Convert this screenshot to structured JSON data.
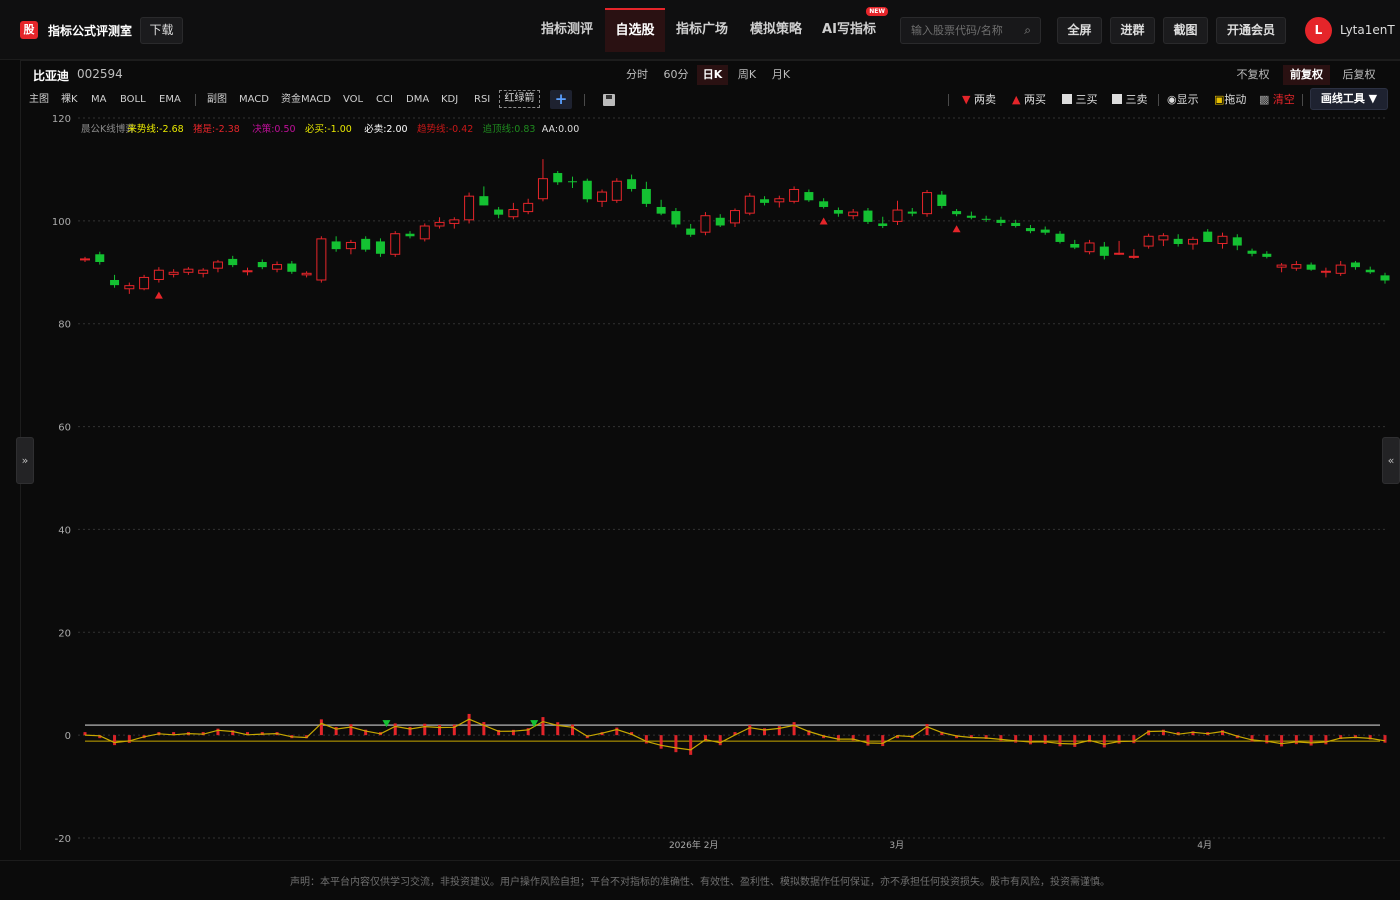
{
  "header": {
    "logo_text": "股",
    "site_name": "指标公式评测室",
    "download_label": "下载",
    "nav": [
      {
        "label": "指标测评",
        "active": false
      },
      {
        "label": "自选股",
        "active": true
      },
      {
        "label": "指标广场",
        "active": false
      },
      {
        "label": "模拟策略",
        "active": false
      },
      {
        "label": "AI写指标",
        "active": false,
        "badge": "NEW"
      }
    ],
    "search_placeholder": "输入股票代码/名称",
    "buttons": [
      "全屏",
      "进群",
      "截图",
      "开通会员"
    ],
    "avatar_letter": "L",
    "username": "Lyta1enT"
  },
  "stock": {
    "name": "比亚迪",
    "code": "002594"
  },
  "periods": [
    {
      "label": "分时",
      "active": false
    },
    {
      "label": "60分",
      "active": false
    },
    {
      "label": "日K",
      "active": true
    },
    {
      "label": "周K",
      "active": false
    },
    {
      "label": "月K",
      "active": false
    }
  ],
  "adjust": [
    {
      "label": "不复权",
      "active": false
    },
    {
      "label": "前复权",
      "active": true
    },
    {
      "label": "后复权",
      "active": false
    }
  ],
  "indicator_tabs_main": [
    "主图",
    "裸K",
    "MA",
    "BOLL",
    "EMA"
  ],
  "indicator_tabs_sub": [
    "副图",
    "MACD",
    "资金MACD",
    "VOL",
    "CCI",
    "DMA",
    "KDJ",
    "RSI"
  ],
  "active_indicator": "红绿箭",
  "tools": {
    "two_sell": "两卖",
    "two_buy": "两买",
    "three_buy": "三买",
    "three_sell": "三卖",
    "show": "显示",
    "drag": "拖动",
    "clear": "清空",
    "draw_tools": "画线工具 ▼"
  },
  "legend": [
    {
      "text": "晨公K线博弈",
      "color": "#8a8a8a"
    },
    {
      "text": "来势线:-2.68",
      "color": "#e8e800"
    },
    {
      "text": "猪是:-2.38",
      "color": "#e5252a"
    },
    {
      "text": "决策:0.50",
      "color": "#c0109a"
    },
    {
      "text": "必买:-1.00",
      "color": "#e8e800"
    },
    {
      "text": "必卖:2.00",
      "color": "#ffffff"
    },
    {
      "text": "趋势线:-0.42",
      "color": "#c81818"
    },
    {
      "text": "追顶线:0.83",
      "color": "#1f8a1f"
    },
    {
      "text": "AA:0.00",
      "color": "#dddddd"
    }
  ],
  "collapse_left": "»",
  "collapse_right": "«",
  "colors": {
    "up": "#e5252a",
    "down": "#14c132",
    "grid": "#333333",
    "accent": "#e5252a"
  },
  "footer_text": "声明：本平台内容仅供学习交流，非投资建议。用户操作风险自担；平台不对指标的准确性、有效性、盈利性、模拟数据作任何保证，亦不承担任何投资损失。股市有风险，投资需谨慎。",
  "chart_data": {
    "type": "candlestick",
    "ylim": [
      -20,
      120
    ],
    "y_ticks": [
      120,
      100,
      80,
      60,
      40,
      20,
      0,
      -20
    ],
    "x_tick_labels": [
      "2026年 2月",
      "3月",
      "4月"
    ],
    "candles": [
      [
        92.5,
        93,
        92,
        92.6
      ],
      [
        93.5,
        94,
        91.5,
        92.0
      ],
      [
        88.5,
        89.5,
        87.0,
        87.5
      ],
      [
        86.8,
        88.0,
        85.8,
        87.4
      ],
      [
        86.8,
        89.5,
        86.5,
        89.0
      ],
      [
        88.6,
        91.0,
        88.0,
        90.4
      ],
      [
        89.6,
        90.6,
        89.0,
        90.0
      ],
      [
        90.0,
        91.0,
        89.5,
        90.6
      ],
      [
        89.8,
        90.8,
        89.0,
        90.4
      ],
      [
        90.8,
        92.4,
        90.0,
        92.0
      ],
      [
        92.6,
        93.2,
        91.0,
        91.4
      ],
      [
        90.1,
        90.9,
        89.4,
        90.3
      ],
      [
        92.0,
        92.5,
        90.6,
        91.0
      ],
      [
        90.6,
        92.1,
        90.0,
        91.5
      ],
      [
        91.7,
        92.2,
        89.7,
        90.1
      ],
      [
        89.5,
        90.2,
        89.0,
        89.8
      ],
      [
        88.5,
        97.0,
        88.0,
        96.5
      ],
      [
        96.0,
        97.0,
        94.0,
        94.5
      ],
      [
        94.6,
        96.3,
        93.5,
        95.8
      ],
      [
        96.5,
        97.0,
        94.0,
        94.4
      ],
      [
        96.0,
        96.6,
        93.0,
        93.6
      ],
      [
        93.5,
        98.0,
        93.0,
        97.5
      ],
      [
        97.5,
        98.0,
        96.6,
        97.0
      ],
      [
        96.5,
        99.5,
        96.0,
        99.0
      ],
      [
        99.0,
        100.7,
        98.5,
        99.7
      ],
      [
        99.5,
        100.7,
        98.5,
        100.2
      ],
      [
        100.2,
        105.5,
        99.5,
        104.8
      ],
      [
        104.8,
        106.7,
        103.0,
        103.0
      ],
      [
        102.2,
        102.7,
        100.5,
        101.2
      ],
      [
        100.8,
        103.5,
        100.3,
        102.2
      ],
      [
        101.8,
        104.3,
        101.3,
        103.4
      ],
      [
        104.3,
        112.0,
        103.8,
        108.2
      ],
      [
        109.3,
        109.7,
        107.0,
        107.5
      ],
      [
        107.7,
        108.6,
        106.4,
        107.6
      ],
      [
        107.8,
        108.2,
        103.6,
        104.2
      ],
      [
        103.8,
        106.1,
        102.7,
        105.6
      ],
      [
        104.0,
        108.3,
        103.5,
        107.7
      ],
      [
        108.1,
        109.0,
        105.7,
        106.2
      ],
      [
        106.2,
        107.6,
        102.7,
        103.3
      ],
      [
        102.7,
        104.1,
        101.1,
        101.4
      ],
      [
        101.9,
        102.5,
        98.7,
        99.3
      ],
      [
        98.5,
        99.4,
        96.9,
        97.3
      ],
      [
        97.8,
        101.7,
        97.2,
        101.0
      ],
      [
        100.6,
        101.3,
        98.8,
        99.1
      ],
      [
        99.6,
        102.4,
        98.8,
        102.0
      ],
      [
        101.5,
        105.4,
        101.1,
        104.8
      ],
      [
        104.2,
        104.8,
        103.0,
        103.5
      ],
      [
        103.7,
        104.9,
        102.6,
        104.3
      ],
      [
        103.8,
        106.7,
        103.4,
        106.1
      ],
      [
        105.6,
        106.1,
        103.7,
        104.0
      ],
      [
        103.8,
        104.4,
        102.4,
        102.7
      ],
      [
        102.1,
        102.6,
        100.8,
        101.4
      ],
      [
        101.0,
        102.3,
        100.3,
        101.7
      ],
      [
        102.0,
        102.5,
        99.4,
        99.8
      ],
      [
        99.5,
        100.8,
        98.6,
        99.0
      ],
      [
        99.9,
        103.9,
        99.2,
        102.1
      ],
      [
        101.8,
        102.5,
        100.9,
        101.4
      ],
      [
        101.4,
        106.0,
        100.8,
        105.5
      ],
      [
        105.1,
        105.8,
        102.4,
        102.9
      ],
      [
        101.9,
        102.3,
        100.9,
        101.3
      ],
      [
        101.0,
        101.8,
        100.3,
        100.6
      ],
      [
        100.4,
        101.0,
        99.8,
        100.2
      ],
      [
        100.2,
        100.8,
        99.0,
        99.6
      ],
      [
        99.6,
        100.2,
        98.7,
        99.0
      ],
      [
        98.6,
        99.2,
        97.6,
        98.0
      ],
      [
        98.3,
        98.9,
        97.3,
        97.7
      ],
      [
        97.5,
        98.0,
        95.6,
        95.9
      ],
      [
        95.5,
        96.3,
        94.5,
        94.8
      ],
      [
        94.0,
        96.3,
        93.5,
        95.7
      ],
      [
        95.0,
        95.9,
        92.5,
        93.2
      ],
      [
        93.6,
        96.1,
        93.4,
        93.7
      ],
      [
        92.9,
        94.5,
        92.6,
        93.1
      ],
      [
        95.1,
        97.5,
        94.6,
        97.0
      ],
      [
        96.3,
        97.6,
        95.1,
        97.1
      ],
      [
        96.5,
        97.4,
        95.0,
        95.5
      ],
      [
        95.5,
        96.9,
        94.4,
        96.4
      ],
      [
        97.9,
        98.4,
        95.9,
        95.9
      ],
      [
        95.6,
        97.7,
        94.6,
        97.0
      ],
      [
        96.8,
        97.4,
        94.3,
        95.2
      ],
      [
        94.2,
        94.6,
        93.1,
        93.6
      ],
      [
        93.6,
        94.1,
        92.7,
        93.0
      ],
      [
        91.0,
        91.8,
        90.0,
        91.4
      ],
      [
        90.8,
        92.2,
        90.3,
        91.5
      ],
      [
        91.5,
        91.9,
        90.3,
        90.5
      ],
      [
        90.1,
        90.9,
        89.0,
        90.2
      ],
      [
        89.8,
        92.2,
        89.3,
        91.4
      ],
      [
        91.9,
        92.2,
        90.5,
        91.0
      ],
      [
        90.5,
        91.1,
        89.7,
        90.0
      ],
      [
        89.4,
        89.9,
        87.8,
        88.4
      ]
    ],
    "markers_up": [
      5,
      50,
      59
    ],
    "markers_down": [
      20,
      30
    ]
  }
}
